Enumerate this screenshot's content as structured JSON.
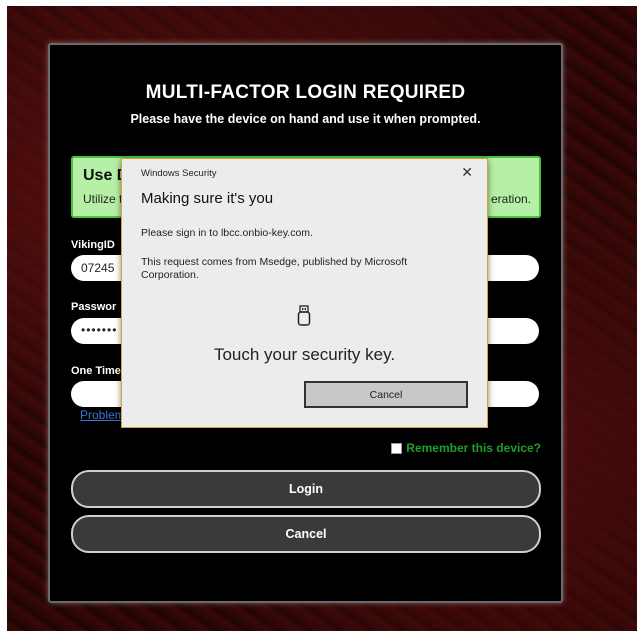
{
  "login": {
    "title": "MULTI-FACTOR LOGIN REQUIRED",
    "subtitle": "Please have the device on hand and use it when prompted.",
    "notice": {
      "title_visible": "Use D",
      "text_visible_left": "Utilize t",
      "text_visible_right": "eration."
    },
    "viking_id": {
      "label_visible": "VikingID",
      "value_visible": "07245"
    },
    "password": {
      "label_visible": "Passwor",
      "value_masked": "•••••••"
    },
    "otp": {
      "label_visible": "One Time"
    },
    "problem_link_visible": "Problem",
    "remember_label": "Remember this device?",
    "login_button": "Login",
    "cancel_button": "Cancel"
  },
  "dialog": {
    "header": "Windows Security",
    "close_glyph": "✕",
    "title": "Making sure it's you",
    "line1": "Please sign in to lbcc.onbio-key.com.",
    "line2": "This request comes from Msedge, published by Microsoft Corporation.",
    "icon": "usb-security-key-icon",
    "prompt": "Touch your security key.",
    "cancel": "Cancel"
  },
  "colors": {
    "notice_bg": "#b6f0a6",
    "notice_border": "#4cc23a",
    "remember_text": "#1e9e2a",
    "link": "#3b78d6",
    "dialog_border": "#d4a33a"
  }
}
